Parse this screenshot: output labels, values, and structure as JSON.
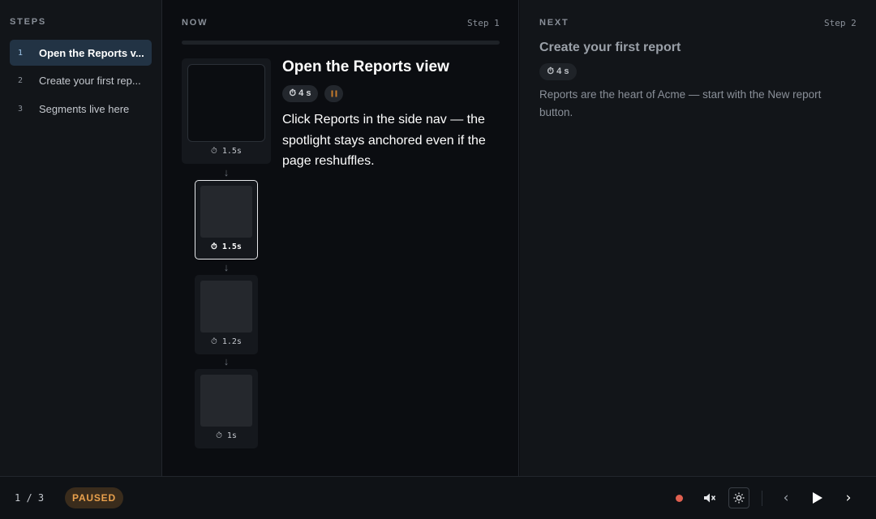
{
  "sidebar": {
    "heading": "STEPS",
    "items": [
      {
        "num": "1",
        "label": "Open the Reports v...",
        "active": true
      },
      {
        "num": "2",
        "label": "Create your first rep...",
        "active": false
      },
      {
        "num": "3",
        "label": "Segments live here",
        "active": false
      }
    ]
  },
  "now": {
    "heading": "NOW",
    "step_label": "Step 1",
    "progress": 0,
    "title": "Open the Reports view",
    "duration": "⏱ 4 s",
    "pause_icon": "pause-icon",
    "body": "Click Reports in the side nav — the spotlight stays anchored even if the page reshuffles.",
    "frames": [
      {
        "duration": "⏱ 1.5s"
      },
      {
        "duration": "⏱ 1.5s"
      },
      {
        "duration": "⏱ 1.2s"
      },
      {
        "duration": "⏱ 1s"
      }
    ],
    "arrow": "↓"
  },
  "next": {
    "heading": "NEXT",
    "step_label": "Step 2",
    "title": "Create your first report",
    "duration": "⏱ 4 s",
    "body": "Reports are the heart of Acme — start with the New report button."
  },
  "footer": {
    "counter": "1 / 3",
    "status": "PAUSED",
    "icons": [
      "record-icon",
      "mute-icon",
      "theme-icon",
      "prev-icon",
      "play-icon",
      "next-icon"
    ],
    "prev_glyph": "‹",
    "next_glyph": "›"
  },
  "colors": {
    "accent": "#223344",
    "status": "#e8a04c",
    "record": "#e06050"
  }
}
